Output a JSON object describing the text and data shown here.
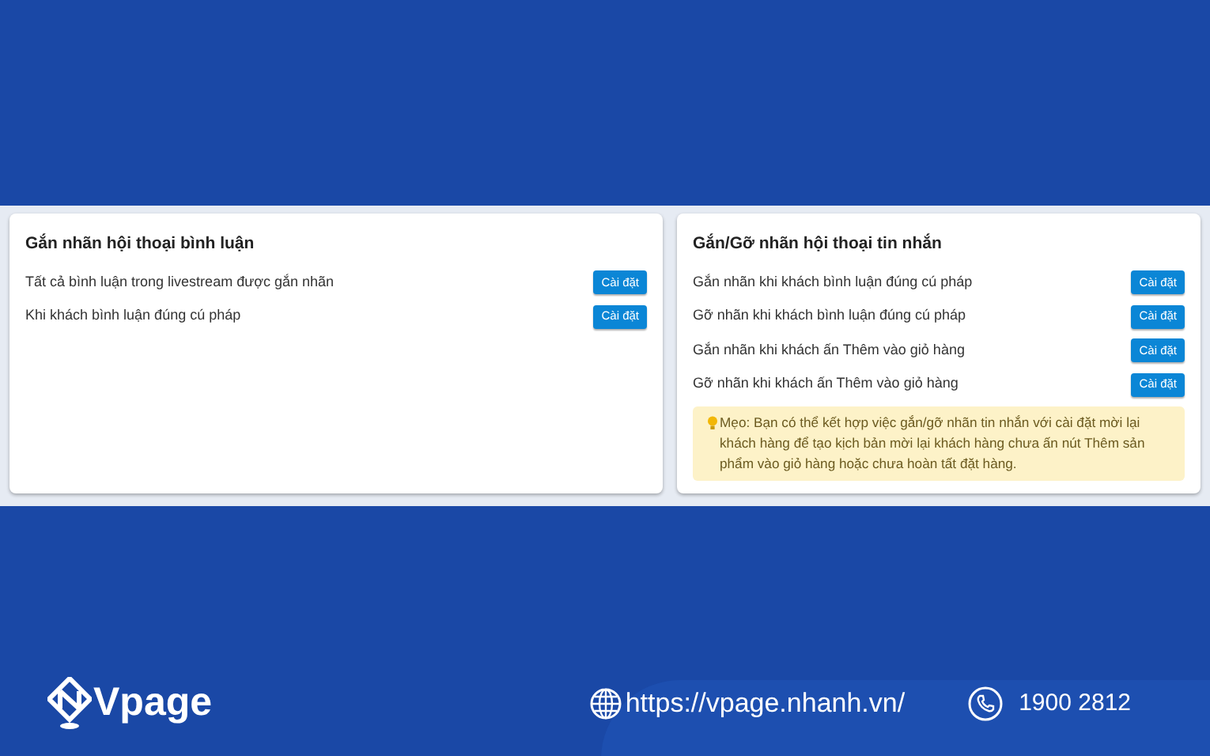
{
  "panels": [
    {
      "title": "Gắn nhãn hội thoại bình luận",
      "rows": [
        {
          "label": "Tất cả bình luận trong livestream được gắn nhãn",
          "button": "Cài đặt"
        },
        {
          "label": "Khi khách bình luận đúng cú pháp",
          "button": "Cài đặt"
        }
      ]
    },
    {
      "title": "Gắn/Gỡ nhãn hội thoại tin nhắn",
      "rows": [
        {
          "label": "Gắn nhãn khi khách bình luận đúng cú pháp",
          "button": "Cài đặt"
        },
        {
          "label": "Gỡ nhãn khi khách bình luận đúng cú pháp",
          "button": "Cài đặt"
        },
        {
          "label": "Gắn nhãn khi khách ấn Thêm vào giỏ hàng",
          "button": "Cài đặt"
        },
        {
          "label": "Gỡ nhãn khi khách ấn Thêm vào giỏ hàng",
          "button": "Cài đặt"
        }
      ],
      "tip": "Mẹo: Bạn có thể kết hợp việc gắn/gỡ nhãn tin nhắn với cài đặt mời lại khách hàng để tạo kịch bản mời lại khách hàng chưa ấn nút Thêm sản phẩm vào giỏ hàng hoặc chưa hoàn tất đặt hàng."
    }
  ],
  "footer": {
    "brand": "Vpage",
    "url": "https://vpage.nhanh.vn/",
    "phone": "1900 2812"
  }
}
